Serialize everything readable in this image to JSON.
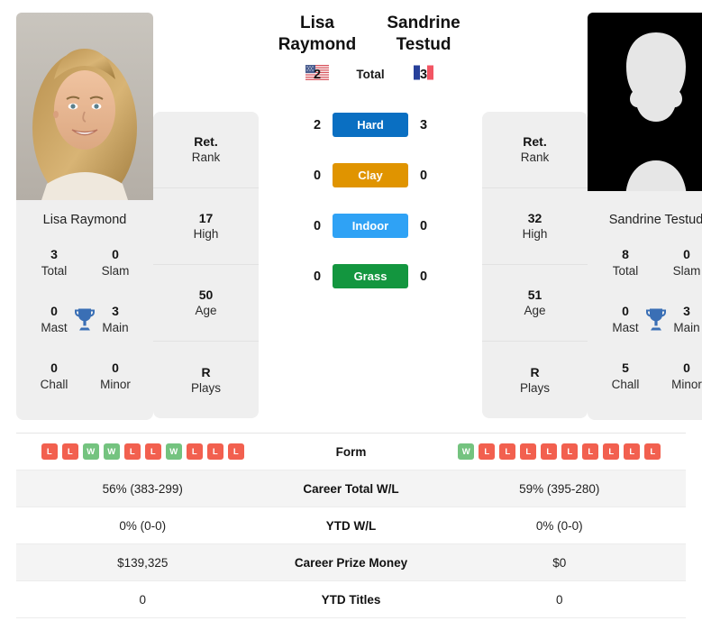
{
  "players": {
    "left": {
      "name": "Lisa Raymond",
      "first_name": "Lisa",
      "last_name": "Raymond",
      "country": "USA",
      "flag_icon": "us-flag-icon",
      "photo": "player-photo",
      "titles": {
        "total": "3",
        "total_label": "Total",
        "slam": "0",
        "slam_label": "Slam",
        "mast": "0",
        "mast_label": "Mast",
        "main": "3",
        "main_label": "Main",
        "chall": "0",
        "chall_label": "Chall",
        "minor": "0",
        "minor_label": "Minor",
        "trophy_icon": "trophy-icon"
      },
      "stats": [
        {
          "value": "Ret.",
          "label": "Rank"
        },
        {
          "value": "17",
          "label": "High"
        },
        {
          "value": "50",
          "label": "Age"
        },
        {
          "value": "R",
          "label": "Plays"
        }
      ],
      "form": [
        "L",
        "L",
        "W",
        "W",
        "L",
        "L",
        "W",
        "L",
        "L",
        "L"
      ],
      "career_total_wl": "56% (383-299)",
      "ytd_wl": "0% (0-0)",
      "career_prize_money": "$139,325",
      "ytd_titles": "0"
    },
    "right": {
      "name": "Sandrine Testud",
      "first_name": "Sandrine",
      "last_name": "Testud",
      "country": "FRA",
      "flag_icon": "fr-flag-icon",
      "photo": "player-photo-placeholder",
      "titles": {
        "total": "8",
        "total_label": "Total",
        "slam": "0",
        "slam_label": "Slam",
        "mast": "0",
        "mast_label": "Mast",
        "main": "3",
        "main_label": "Main",
        "chall": "5",
        "chall_label": "Chall",
        "minor": "0",
        "minor_label": "Minor",
        "trophy_icon": "trophy-icon"
      },
      "stats": [
        {
          "value": "Ret.",
          "label": "Rank"
        },
        {
          "value": "32",
          "label": "High"
        },
        {
          "value": "51",
          "label": "Age"
        },
        {
          "value": "R",
          "label": "Plays"
        }
      ],
      "form": [
        "W",
        "L",
        "L",
        "L",
        "L",
        "L",
        "L",
        "L",
        "L",
        "L"
      ],
      "career_total_wl": "59% (395-280)",
      "ytd_wl": "0% (0-0)",
      "career_prize_money": "$0",
      "ytd_titles": "0"
    }
  },
  "head_to_head": [
    {
      "label": "Total",
      "left": "2",
      "right": "3",
      "color": "transparent",
      "plain": true
    },
    {
      "label": "Hard",
      "left": "2",
      "right": "3",
      "color": "#0a6fc2",
      "plain": false
    },
    {
      "label": "Clay",
      "left": "0",
      "right": "0",
      "color": "#e09400",
      "plain": false
    },
    {
      "label": "Indoor",
      "left": "0",
      "right": "0",
      "color": "#2fa2f5",
      "plain": false
    },
    {
      "label": "Grass",
      "left": "0",
      "right": "0",
      "color": "#13963f",
      "plain": false
    }
  ],
  "comparison_rows": [
    {
      "label": "Form",
      "left": "",
      "right": "",
      "type": "form"
    },
    {
      "label": "Career Total W/L",
      "left": "56% (383-299)",
      "right": "59% (395-280)",
      "type": "text"
    },
    {
      "label": "YTD W/L",
      "left": "0% (0-0)",
      "right": "0% (0-0)",
      "type": "text"
    },
    {
      "label": "Career Prize Money",
      "left": "$139,325",
      "right": "$0",
      "type": "text"
    },
    {
      "label": "YTD Titles",
      "left": "0",
      "right": "0",
      "type": "text"
    }
  ],
  "colors": {
    "card_bg": "#efefef",
    "win": "#74c37f",
    "loss": "#f2604f",
    "hard": "#0a6fc2",
    "clay": "#e09400",
    "indoor": "#2fa2f5",
    "grass": "#13963f",
    "trophy": "#3a6fb5"
  }
}
